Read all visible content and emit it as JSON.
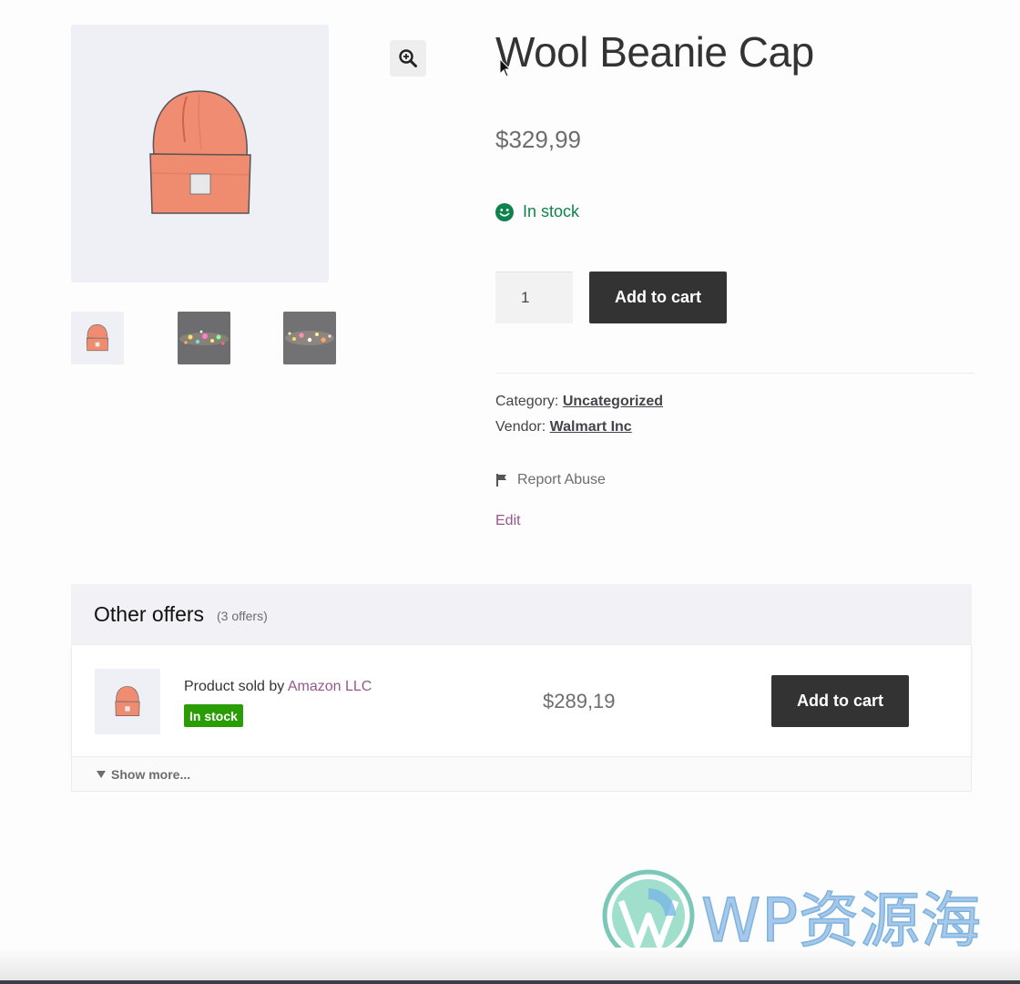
{
  "gallery": {
    "main_image_alt": "beanie-hat-image",
    "zoom_icon": "zoom-in-icon",
    "thumbnails": [
      "beanie-thumb",
      "sparkle-thumb-1",
      "sparkle-thumb-2"
    ]
  },
  "product": {
    "title": "Wool Beanie Cap",
    "price": "$329,99",
    "stock_text": "In stock",
    "quantity": "1",
    "add_to_cart": "Add to cart",
    "category_label": "Category:",
    "category_value": "Uncategorized",
    "vendor_label": "Vendor:",
    "vendor_value": "Walmart Inc",
    "report_abuse": "Report Abuse",
    "edit": "Edit"
  },
  "offers": {
    "title": "Other offers",
    "count": "(3 offers)",
    "items": [
      {
        "seller_prefix": "Product sold by",
        "seller_name": "Amazon LLC",
        "badge": "In stock",
        "price": "$289,19",
        "add_to_cart": "Add to cart"
      }
    ],
    "show_more": "Show more..."
  },
  "watermark": {
    "text": "WP资源海"
  },
  "colors": {
    "accent_purple": "#96588a",
    "stock_green": "#0f834d",
    "badge_green": "#2a9d05",
    "button_dark": "#333333"
  }
}
